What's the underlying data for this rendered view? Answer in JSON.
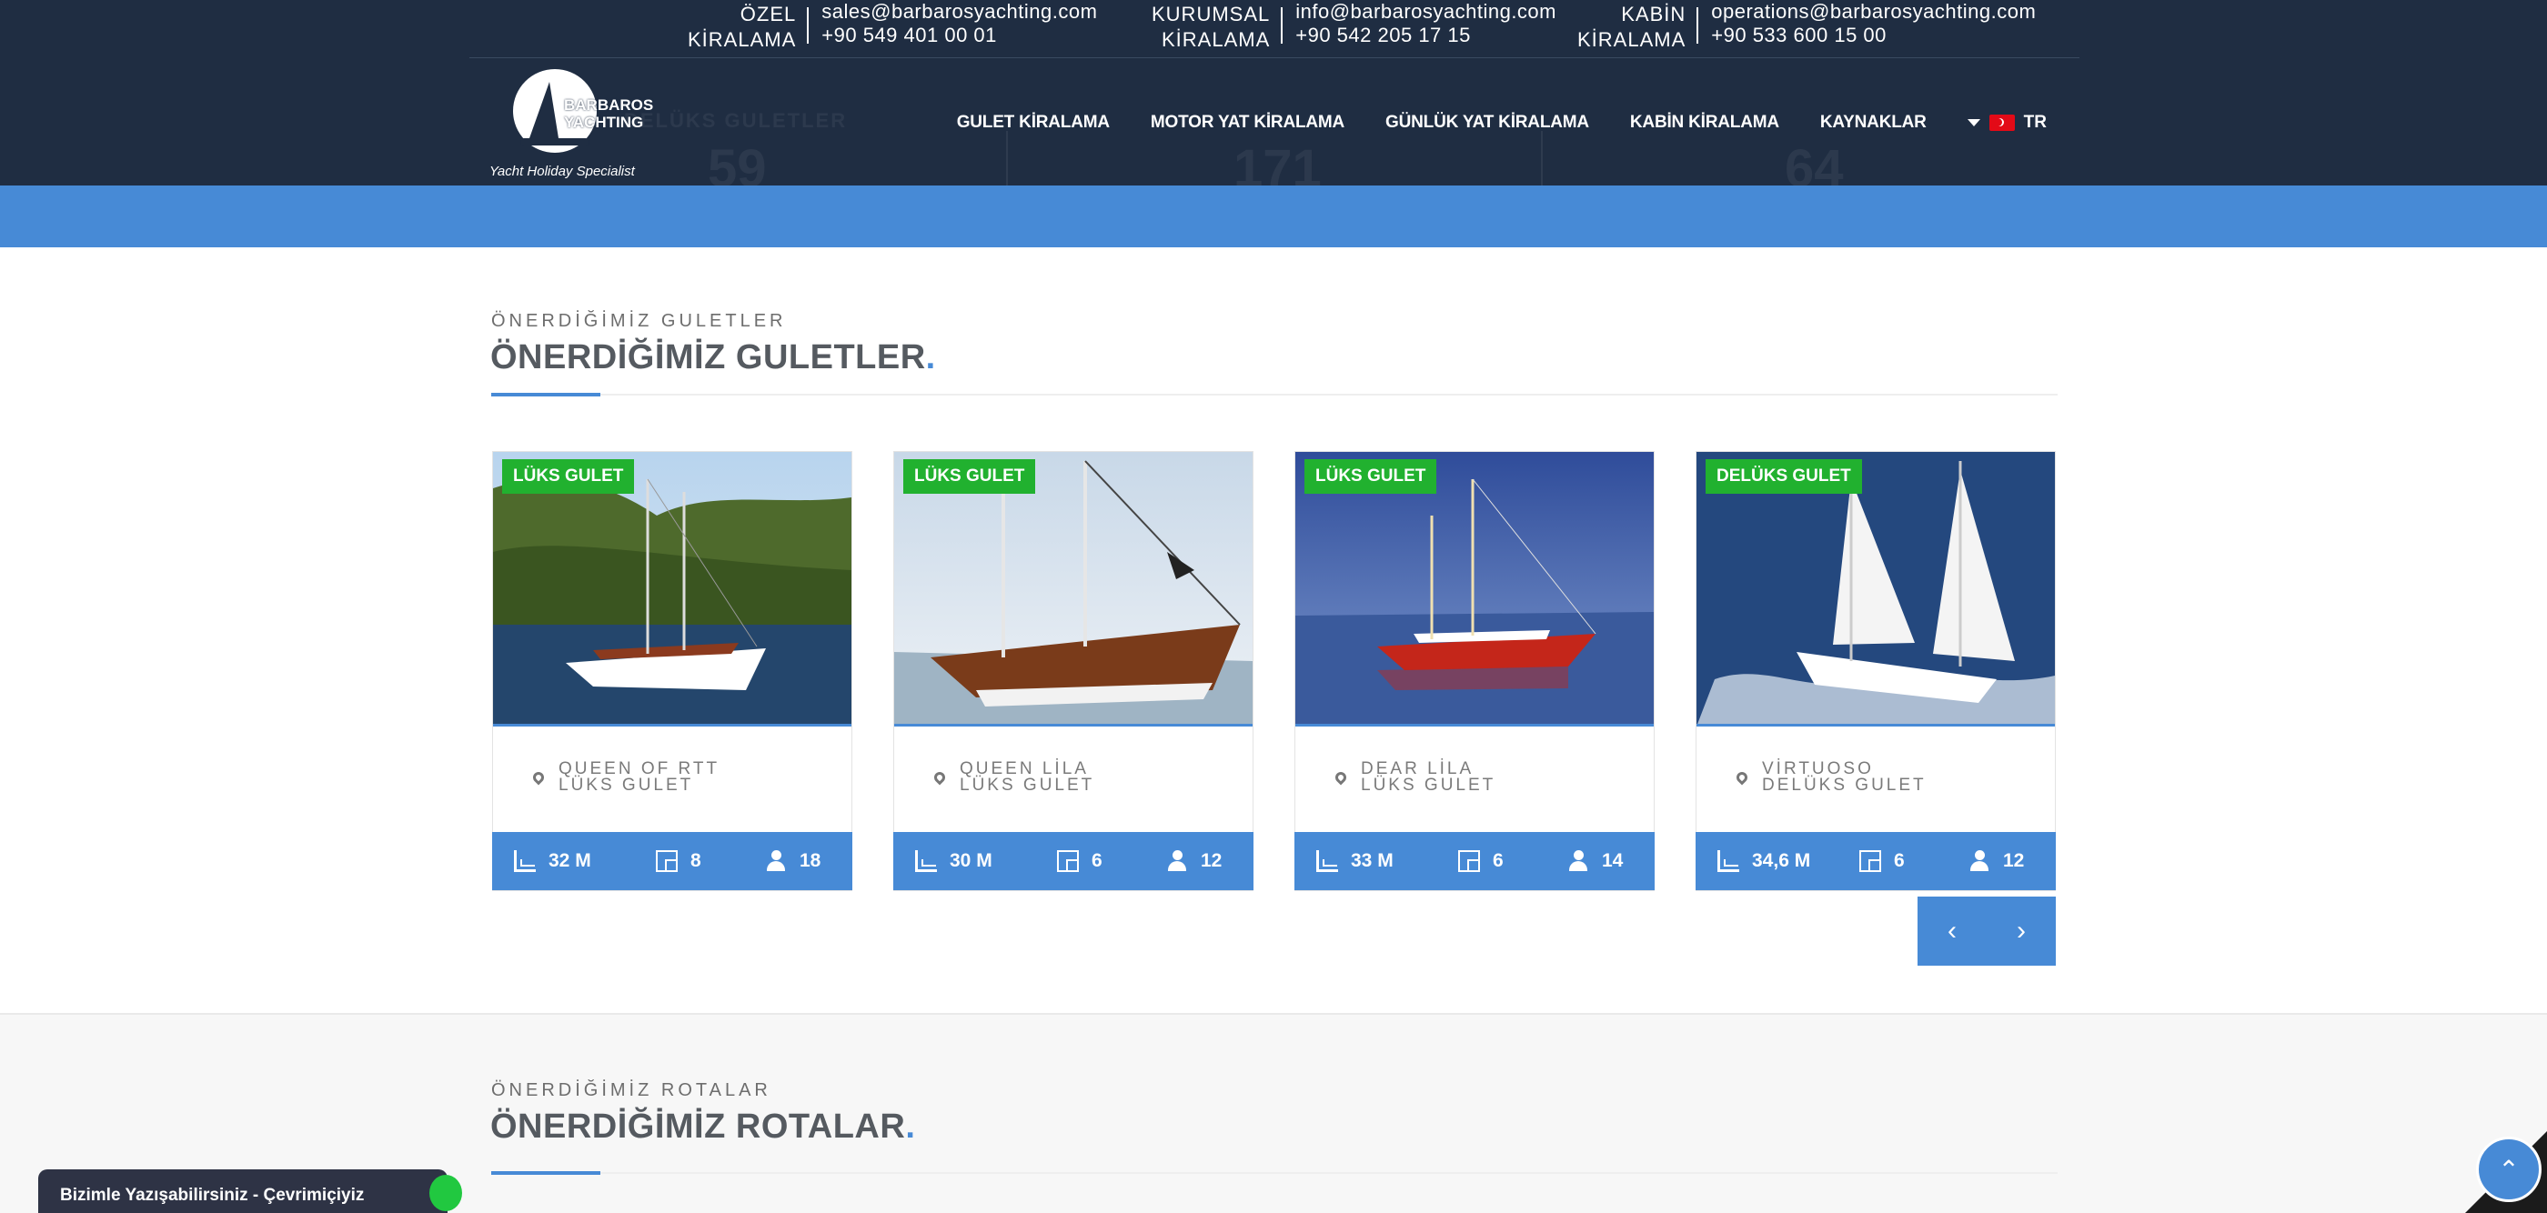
{
  "contacts": [
    {
      "label1": "ÖZEL",
      "label2": "KİRALAMA",
      "email": "sales@barbarosyachting.com",
      "phone": "+90 549 401 00 01"
    },
    {
      "label1": "KURUMSAL",
      "label2": "KİRALAMA",
      "email": "info@barbarosyachting.com",
      "phone": "+90 542 205 17 15"
    },
    {
      "label1": "KABİN",
      "label2": "KİRALAMA",
      "email": "operations@barbarosyachting.com",
      "phone": "+90 533 600 15 00"
    }
  ],
  "logo": {
    "brand_line1": "BARBAROS",
    "brand_line2": "YACHTING",
    "tagline": "Yacht Holiday Specialist"
  },
  "stats_ghost": [
    {
      "label": "DELÜKS GULETLER",
      "value": "59"
    },
    {
      "label": "",
      "value": "171"
    },
    {
      "label": "",
      "value": "64"
    }
  ],
  "nav": {
    "items": [
      "GULET KİRALAMA",
      "MOTOR YAT KİRALAMA",
      "GÜNLÜK YAT KİRALAMA",
      "KABİN KİRALAMA",
      "KAYNAKLAR"
    ],
    "lang": "TR"
  },
  "section_gulets": {
    "kicker": "ÖNERDİĞİMİZ GULETLER",
    "title": "ÖNERDİĞİMİZ GULETLER",
    "title_dot": "."
  },
  "cards": [
    {
      "badge": "LÜKS GULET",
      "name": "QUEEN OF RTT",
      "type": "LÜKS GULET",
      "length": "32 M",
      "cabins": "8",
      "guests": "18"
    },
    {
      "badge": "LÜKS GULET",
      "name": "QUEEN LİLA",
      "type": "LÜKS GULET",
      "length": "30 M",
      "cabins": "6",
      "guests": "12"
    },
    {
      "badge": "LÜKS GULET",
      "name": "DEAR LİLA",
      "type": "LÜKS GULET",
      "length": "33 M",
      "cabins": "6",
      "guests": "14"
    },
    {
      "badge": "DELÜKS GULET",
      "name": "VİRTUOSO",
      "type": "DELÜKS GULET",
      "length": "34,6 M",
      "cabins": "6",
      "guests": "12"
    }
  ],
  "carousel": {
    "prev": "‹",
    "next": "›"
  },
  "section_routes": {
    "kicker": "ÖNERDİĞİMİZ ROTALAR",
    "title": "ÖNERDİĞİMİZ ROTALAR",
    "title_dot": "."
  },
  "chat": {
    "label": "Bizimle Yazışabilirsiniz - Çevrimiçiyiz"
  },
  "totop": {
    "glyph": "⌃"
  },
  "colors": {
    "header_bg": "#1f2d42",
    "accent": "#478ad6",
    "badge": "#21b12f"
  }
}
